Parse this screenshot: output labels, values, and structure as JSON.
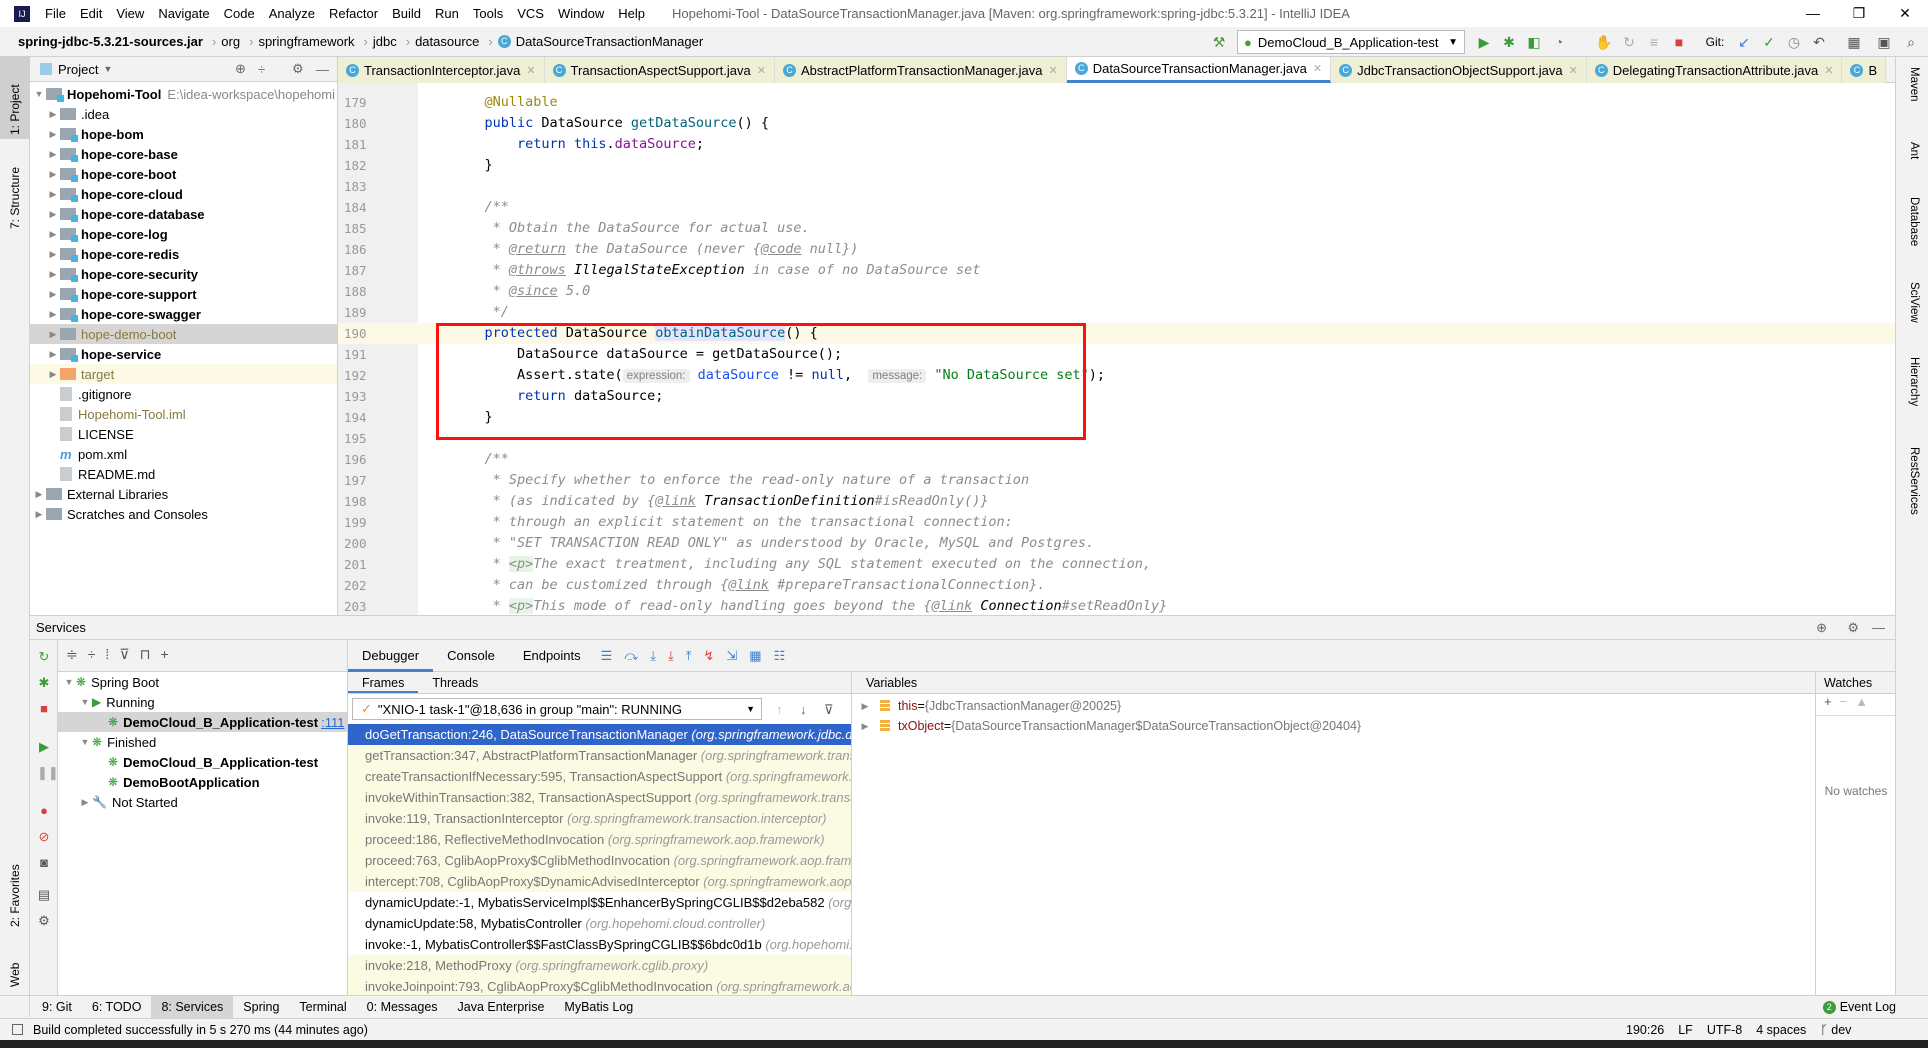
{
  "window": {
    "title": "Hopehomi-Tool - DataSourceTransactionManager.java [Maven: org.springframework:spring-jdbc:5.3.21] - IntelliJ IDEA",
    "menu": [
      "File",
      "Edit",
      "View",
      "Navigate",
      "Code",
      "Analyze",
      "Refactor",
      "Build",
      "Run",
      "Tools",
      "VCS",
      "Window",
      "Help"
    ]
  },
  "breadcrumb": [
    "spring-jdbc-5.3.21-sources.jar",
    "org",
    "springframework",
    "jdbc",
    "datasource",
    "DataSourceTransactionManager"
  ],
  "run_config": "DemoCloud_B_Application-test",
  "git_label": "Git:",
  "left_strip": [
    "1: Project",
    "7: Structure",
    "2: Favorites",
    "Web"
  ],
  "right_strip": [
    "Maven",
    "Ant",
    "Database",
    "SciView",
    "Hierarchy",
    "RestServices"
  ],
  "project": {
    "header": "Project",
    "root": {
      "name": "Hopehomi-Tool",
      "path": "E:\\idea-workspace\\hopehomi"
    },
    "items": [
      {
        "name": ".idea",
        "type": "folder",
        "style": "normal"
      },
      {
        "name": "hope-bom",
        "type": "module",
        "style": "bold"
      },
      {
        "name": "hope-core-base",
        "type": "module",
        "style": "bold"
      },
      {
        "name": "hope-core-boot",
        "type": "module",
        "style": "bold"
      },
      {
        "name": "hope-core-cloud",
        "type": "module",
        "style": "bold"
      },
      {
        "name": "hope-core-database",
        "type": "module",
        "style": "bold"
      },
      {
        "name": "hope-core-log",
        "type": "module",
        "style": "bold"
      },
      {
        "name": "hope-core-redis",
        "type": "module",
        "style": "bold"
      },
      {
        "name": "hope-core-security",
        "type": "module",
        "style": "bold"
      },
      {
        "name": "hope-core-support",
        "type": "module",
        "style": "bold"
      },
      {
        "name": "hope-core-swagger",
        "type": "module",
        "style": "bold"
      },
      {
        "name": "hope-demo-boot",
        "type": "folder",
        "style": "excluded"
      },
      {
        "name": "hope-service",
        "type": "module",
        "style": "bold"
      },
      {
        "name": "target",
        "type": "target",
        "style": "excluded"
      },
      {
        "name": ".gitignore",
        "type": "file",
        "style": "normal"
      },
      {
        "name": "Hopehomi-Tool.iml",
        "type": "file",
        "style": "excluded"
      },
      {
        "name": "LICENSE",
        "type": "file",
        "style": "normal"
      },
      {
        "name": "pom.xml",
        "type": "maven",
        "style": "normal"
      },
      {
        "name": "README.md",
        "type": "file",
        "style": "normal"
      }
    ],
    "extra": [
      "External Libraries",
      "Scratches and Consoles"
    ]
  },
  "editor": {
    "tabs": [
      "TransactionInterceptor.java",
      "TransactionAspectSupport.java",
      "AbstractPlatformTransactionManager.java",
      "DataSourceTransactionManager.java",
      "JdbcTransactionObjectSupport.java",
      "DelegatingTransactionAttribute.java",
      "B"
    ],
    "active_tab": 3,
    "lines": [
      {
        "n": "179",
        "t": [
          [
            "    ",
            ""
          ],
          [
            "@Nullable",
            "ann"
          ]
        ]
      },
      {
        "n": "180",
        "t": [
          [
            "    ",
            ""
          ],
          [
            "public ",
            "kw"
          ],
          [
            "DataSource ",
            ""
          ],
          [
            "getDataSource",
            "fn"
          ],
          [
            "() {",
            ""
          ]
        ]
      },
      {
        "n": "181",
        "t": [
          [
            "        ",
            ""
          ],
          [
            "return ",
            "kw"
          ],
          [
            "this",
            "kw"
          ],
          [
            ".",
            ""
          ],
          [
            "dataSource",
            "fld"
          ],
          [
            ";",
            ""
          ]
        ]
      },
      {
        "n": "182",
        "t": [
          [
            "    }",
            ""
          ]
        ]
      },
      {
        "n": "183",
        "t": []
      },
      {
        "n": "184",
        "t": [
          [
            "    ",
            ""
          ],
          [
            "/**",
            "cm"
          ]
        ]
      },
      {
        "n": "185",
        "t": [
          [
            "     * Obtain the DataSource for actual use.",
            "cm"
          ]
        ]
      },
      {
        "n": "186",
        "t": [
          [
            "     * ",
            "cm"
          ],
          [
            "@return",
            "tag"
          ],
          [
            " the DataSource (never {",
            "cm"
          ],
          [
            "@code",
            "tag"
          ],
          [
            " null})",
            "cm"
          ]
        ]
      },
      {
        "n": "187",
        "t": [
          [
            "     * ",
            "cm"
          ],
          [
            "@throws",
            "tag"
          ],
          [
            " ",
            "cm"
          ],
          [
            "IllegalStateException",
            "cmb"
          ],
          [
            " in case of no DataSource set",
            "cm"
          ]
        ]
      },
      {
        "n": "188",
        "t": [
          [
            "     * ",
            "cm"
          ],
          [
            "@since",
            "tag"
          ],
          [
            " 5.0",
            "cm"
          ]
        ]
      },
      {
        "n": "189",
        "t": [
          [
            "     */",
            "cm"
          ]
        ]
      },
      {
        "n": "190",
        "t": [
          [
            "    ",
            ""
          ],
          [
            "protected ",
            "kw"
          ],
          [
            "DataSource ",
            ""
          ],
          [
            "obtainDataSource",
            "fn sel"
          ],
          [
            "() {",
            ""
          ]
        ],
        "cur": true
      },
      {
        "n": "191",
        "t": [
          [
            "        DataSource dataSource = getDataSource();",
            ""
          ]
        ]
      },
      {
        "n": "192",
        "t": [
          [
            "        Assert.state(",
            ""
          ],
          [
            "expression:",
            "hint"
          ],
          [
            " ",
            ""
          ],
          [
            "dataSource",
            "var"
          ],
          [
            " != ",
            ""
          ],
          [
            "null",
            "kw"
          ],
          [
            ",  ",
            ""
          ],
          [
            "message:",
            "hint"
          ],
          [
            " ",
            ""
          ],
          [
            "\"No DataSource set\"",
            "str"
          ],
          [
            ");",
            ""
          ]
        ]
      },
      {
        "n": "193",
        "t": [
          [
            "        ",
            ""
          ],
          [
            "return ",
            "kw"
          ],
          [
            "dataSource;",
            ""
          ]
        ]
      },
      {
        "n": "194",
        "t": [
          [
            "    }",
            ""
          ]
        ]
      },
      {
        "n": "195",
        "t": []
      },
      {
        "n": "196",
        "t": [
          [
            "    ",
            ""
          ],
          [
            "/**",
            "cm"
          ]
        ]
      },
      {
        "n": "197",
        "t": [
          [
            "     * Specify whether to enforce the read-only nature of a transaction",
            "cm"
          ]
        ]
      },
      {
        "n": "198",
        "t": [
          [
            "     * (as indicated by {",
            "cm"
          ],
          [
            "@link",
            "tag"
          ],
          [
            " ",
            "cm"
          ],
          [
            "TransactionDefinition",
            "cmb"
          ],
          [
            "#isReadOnly()}",
            "cm"
          ]
        ]
      },
      {
        "n": "199",
        "t": [
          [
            "     * through an explicit statement on the transactional connection:",
            "cm"
          ]
        ]
      },
      {
        "n": "200",
        "t": [
          [
            "     * \"SET TRANSACTION READ ONLY\" as understood by Oracle, MySQL and Postgres.",
            "cm"
          ]
        ]
      },
      {
        "n": "201",
        "t": [
          [
            "     * ",
            "cm"
          ],
          [
            "<p>",
            "pt"
          ],
          [
            "The exact treatment, including any SQL statement executed on the connection,",
            "cm"
          ]
        ]
      },
      {
        "n": "202",
        "t": [
          [
            "     * can be customized through {",
            "cm"
          ],
          [
            "@link",
            "tag"
          ],
          [
            " #prepareTransactionalConnection}.",
            "cm"
          ]
        ]
      },
      {
        "n": "203",
        "t": [
          [
            "     * ",
            "cm"
          ],
          [
            "<p>",
            "pt"
          ],
          [
            "This mode of read-only handling goes beyond the {",
            "cm"
          ],
          [
            "@link",
            "tag"
          ],
          [
            " ",
            "cm"
          ],
          [
            "Connection",
            "cmb"
          ],
          [
            "#setReadOnly}",
            "cm"
          ]
        ]
      }
    ]
  },
  "services": {
    "title": "Services",
    "tree": [
      {
        "label": "Spring Boot",
        "depth": 0,
        "arrow": "▼",
        "style": ""
      },
      {
        "label": "Running",
        "depth": 1,
        "arrow": "▼",
        "style": ""
      },
      {
        "label": "DemoCloud_B_Application-test",
        "suffix": ":111",
        "depth": 2,
        "arrow": "",
        "style": "bold",
        "selected": true
      },
      {
        "label": "Finished",
        "depth": 1,
        "arrow": "▼",
        "style": ""
      },
      {
        "label": "DemoCloud_B_Application-test",
        "depth": 2,
        "arrow": "",
        "style": "bold"
      },
      {
        "label": "DemoBootApplication",
        "depth": 2,
        "arrow": "",
        "style": "bold"
      },
      {
        "label": "Not Started",
        "depth": 1,
        "arrow": "▶",
        "style": ""
      }
    ]
  },
  "debugger": {
    "tabs": [
      "Debugger",
      "Console",
      "Endpoints"
    ],
    "frames_tab": "Frames",
    "threads_tab": "Threads",
    "thread": "\"XNIO-1 task-1\"@18,636 in group \"main\": RUNNING",
    "frames": [
      {
        "m": "doGetTransaction:246, DataSourceTransactionManager",
        "p": "(org.springframework.jdbc.datasource)",
        "kind": "on"
      },
      {
        "m": "getTransaction:347, AbstractPlatformTransactionManager",
        "p": "(org.springframework.transaction.support)",
        "kind": "lib"
      },
      {
        "m": "createTransactionIfNecessary:595, TransactionAspectSupport",
        "p": "(org.springframework.transaction.interceptor)",
        "kind": "lib"
      },
      {
        "m": "invokeWithinTransaction:382, TransactionAspectSupport",
        "p": "(org.springframework.transaction.interceptor)",
        "kind": "lib"
      },
      {
        "m": "invoke:119, TransactionInterceptor",
        "p": "(org.springframework.transaction.interceptor)",
        "kind": "lib"
      },
      {
        "m": "proceed:186, ReflectiveMethodInvocation",
        "p": "(org.springframework.aop.framework)",
        "kind": "lib"
      },
      {
        "m": "proceed:763, CglibAopProxy$CglibMethodInvocation",
        "p": "(org.springframework.aop.framework)",
        "kind": "lib"
      },
      {
        "m": "intercept:708, CglibAopProxy$DynamicAdvisedInterceptor",
        "p": "(org.springframework.aop.framework)",
        "kind": "lib"
      },
      {
        "m": "dynamicUpdate:-1, MybatisServiceImpl$$EnhancerBySpringCGLIB$$d2eba582",
        "p": "(org.hopehomi.cloud.service)",
        "kind": "user"
      },
      {
        "m": "dynamicUpdate:58, MybatisController",
        "p": "(org.hopehomi.cloud.controller)",
        "kind": "user"
      },
      {
        "m": "invoke:-1, MybatisController$$FastClassBySpringCGLIB$$6bdc0d1b",
        "p": "(org.hopehomi.cloud.controller)",
        "kind": "user"
      },
      {
        "m": "invoke:218, MethodProxy",
        "p": "(org.springframework.cglib.proxy)",
        "kind": "lib"
      },
      {
        "m": "invokeJoinpoint:793, CglibAopProxy$CglibMethodInvocation",
        "p": "(org.springframework.aop.framework)",
        "kind": "lib"
      }
    ],
    "variables_title": "Variables",
    "variables": [
      {
        "name": "this",
        "value": "{JdbcTransactionManager@20025}"
      },
      {
        "name": "txObject",
        "value": "{DataSourceTransactionManager$DataSourceTransactionObject@20404}"
      }
    ],
    "watches_title": "Watches",
    "no_watches": "No watches"
  },
  "bottom_tabs": [
    {
      "label": "9: Git"
    },
    {
      "label": "6: TODO"
    },
    {
      "label": "8: Services",
      "active": true
    },
    {
      "label": "Spring"
    },
    {
      "label": "Terminal"
    },
    {
      "label": "0: Messages"
    },
    {
      "label": "Java Enterprise"
    },
    {
      "label": "MyBatis Log"
    }
  ],
  "event_log": "Event Log",
  "event_count": "2",
  "status": {
    "message": "Build completed successfully in 5 s 270 ms (44 minutes ago)",
    "position": "190:26",
    "line_sep": "LF",
    "encoding": "UTF-8",
    "indent": "4 spaces",
    "branch": "dev"
  },
  "colors": {
    "accent": "#4083c9",
    "highlight_box": "#ff1010",
    "selected_frame": "#2f65ca"
  }
}
